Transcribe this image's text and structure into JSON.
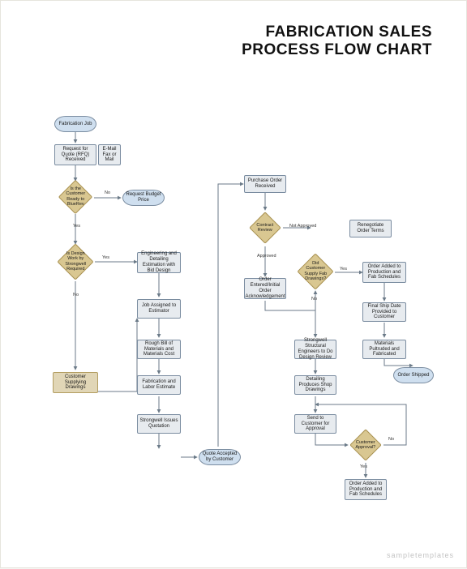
{
  "title": {
    "line1": "FABRICATION SALES",
    "line2": "PROCESS FLOW CHART"
  },
  "nodes": {
    "start": "Fabrication Job",
    "rfq": "Request for Quote (RFQ) Received",
    "rfq_side": "E-Mail Fax or Mail",
    "q_bluerev": "Is the Customer Ready to BlueRev",
    "req_budget": "Request Budget Price",
    "q_design": "Is Design Work by Strongwell Required",
    "engineering": "Engineering and Detailing Estimation with Bid Design",
    "assign": "Job Assigned to Estimator",
    "bill": "Rough Bill of Materials and Materials Cost",
    "cust_supply": "Customer Supplying Drawings",
    "fab_est": "Fabrication and Labor Estimate",
    "issues_quot": "Strongwell Issues Quotation",
    "quote_accept": "Quote Accepted by Customer",
    "po": "Purchase Order Received",
    "q_contract": "Contract Review",
    "not_approved": "Not Approved",
    "reneg": "Renegotiate Order Terms",
    "approved": "Approved",
    "order_entered": "Order Entered/Initial Order Acknowledgement",
    "q_supply_fab": "Did Customer Supply Fab Drawings?",
    "order_added": "Order Added to Production and Fab Schedules",
    "final_ship": "Final Ship Date Provided to Customer",
    "pultruded": "Materials Pultruded and Fabricated",
    "structural": "Strongwell Structural Engineers to Do Design Review",
    "detailing": "Detailing Produces Shop Drawings",
    "send_cust": "Send to Customer for Approval",
    "q_cust_approval": "Customer Approval?",
    "order_added2": "Order Added to Production and Fab Schedules",
    "shipped": "Order Shipped"
  },
  "labels": {
    "yes": "Yes",
    "no": "No"
  },
  "watermark": "sampletemplates"
}
